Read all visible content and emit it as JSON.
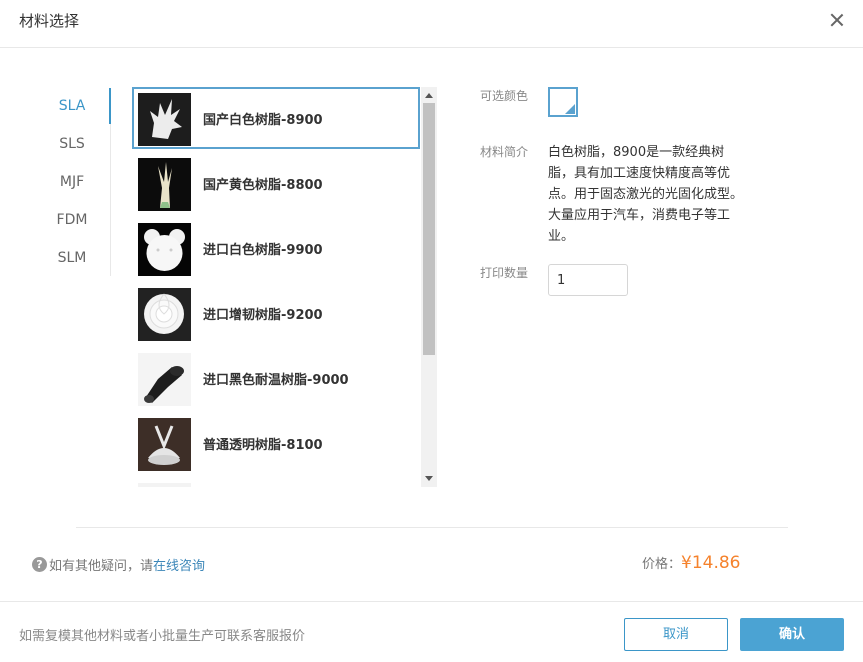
{
  "dialog": {
    "title": "材料选择"
  },
  "categories": [
    {
      "label": "SLA",
      "active": true
    },
    {
      "label": "SLS",
      "active": false
    },
    {
      "label": "MJF",
      "active": false
    },
    {
      "label": "FDM",
      "active": false
    },
    {
      "label": "SLM",
      "active": false
    }
  ],
  "materials": [
    {
      "label": "国产白色树脂-8900",
      "selected": true
    },
    {
      "label": "国产黄色树脂-8800",
      "selected": false
    },
    {
      "label": "进口白色树脂-9900",
      "selected": false
    },
    {
      "label": "进口增韧树脂-9200",
      "selected": false
    },
    {
      "label": "进口黑色耐温树脂-9000",
      "selected": false
    },
    {
      "label": "普通透明树脂-8100",
      "selected": false
    }
  ],
  "detail": {
    "color_label": "可选颜色",
    "selected_color": "#ffffff",
    "intro_label": "材料简介",
    "intro_text": "白色树脂，8900是一款经典树脂，具有加工速度快精度高等优点。用于固态激光的光固化成型。大量应用于汽车，消费电子等工业。",
    "qty_label": "打印数量",
    "qty_value": "1"
  },
  "help": {
    "prefix": "如有其他疑问，请",
    "link": "在线咨询"
  },
  "price": {
    "label": "价格：",
    "value": "¥14.86"
  },
  "footer": {
    "note": "如需复模其他材料或者小批量生产可联系客服报价",
    "cancel_label": "取消",
    "confirm_label": "确认"
  },
  "colors": {
    "accent": "#3b96c8",
    "price": "#f5822c"
  }
}
